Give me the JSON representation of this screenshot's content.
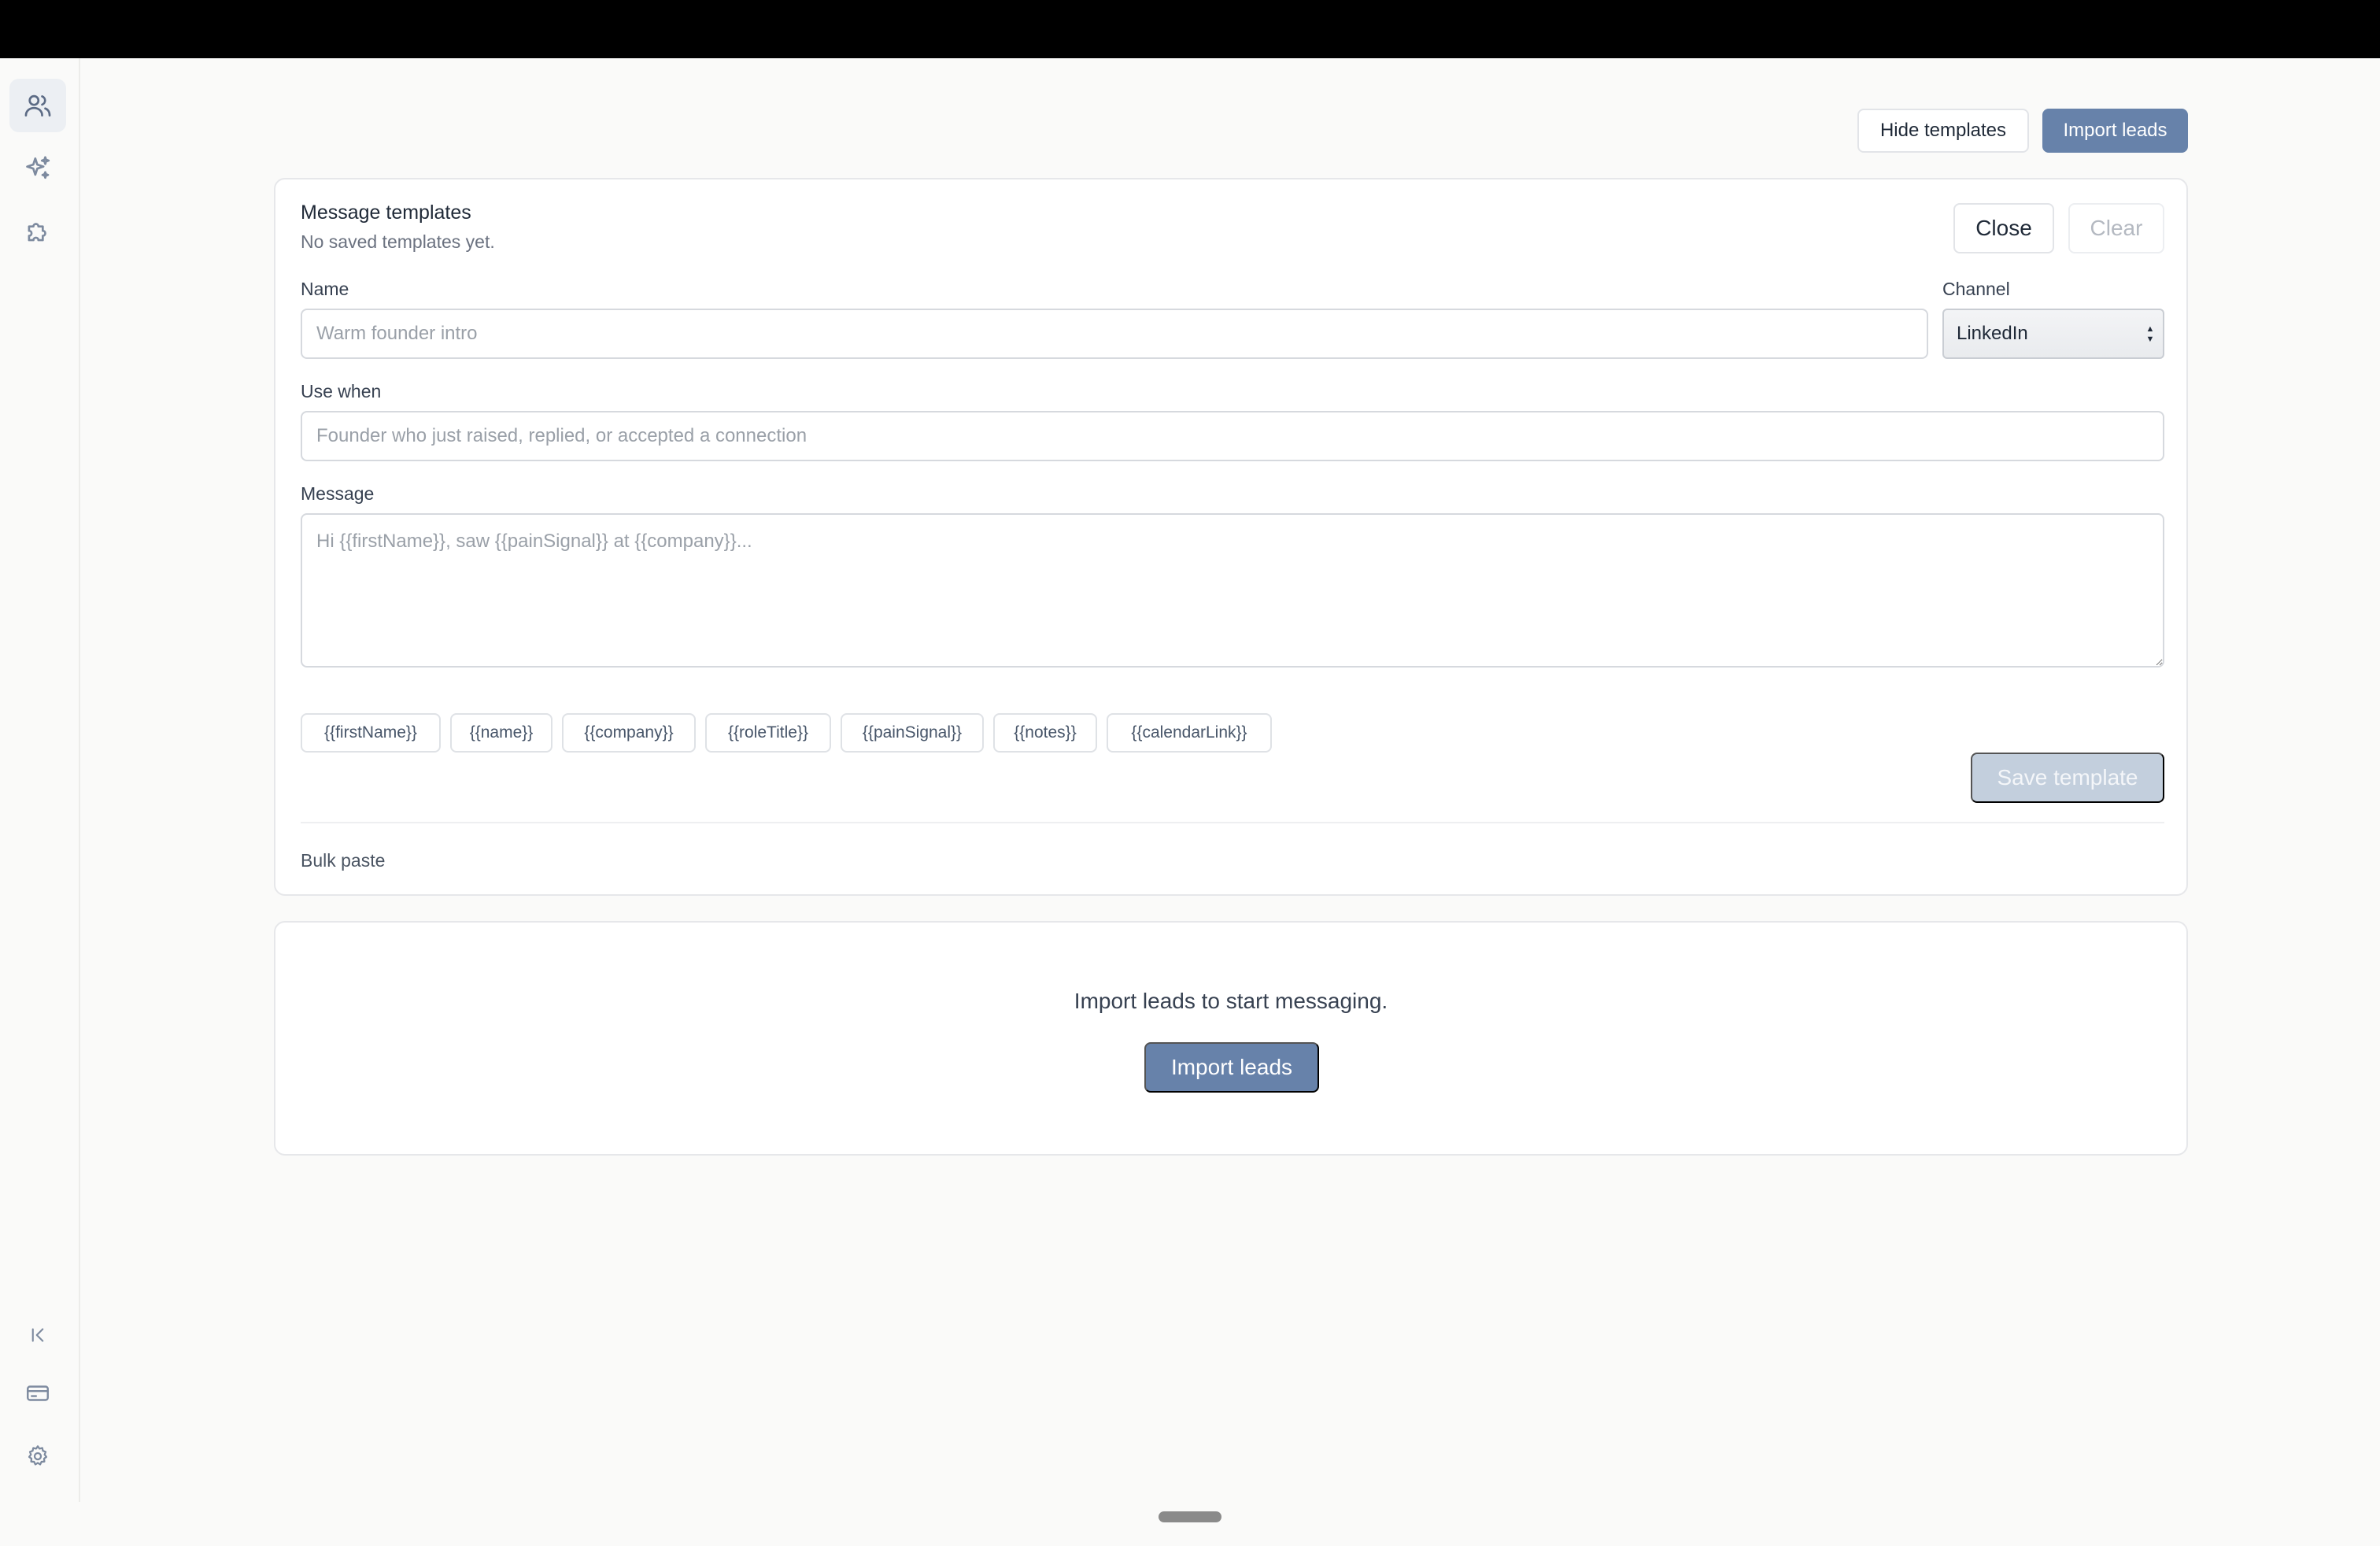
{
  "sidebar": {
    "top_items": [
      {
        "icon": "users-icon",
        "active": true
      },
      {
        "icon": "sparkles-icon",
        "active": false
      },
      {
        "icon": "puzzle-icon",
        "active": false
      }
    ],
    "bottom_items": [
      {
        "icon": "collapse-sidebar-icon"
      },
      {
        "icon": "credit-card-icon"
      },
      {
        "icon": "gear-icon"
      }
    ]
  },
  "toolbar": {
    "hide_templates_label": "Hide templates",
    "import_leads_label": "Import leads"
  },
  "templates_panel": {
    "title": "Message templates",
    "subtitle": "No saved templates yet.",
    "close_label": "Close",
    "clear_label": "Clear",
    "name": {
      "label": "Name",
      "value": "",
      "placeholder": "Warm founder intro"
    },
    "channel": {
      "label": "Channel",
      "selected": "LinkedIn"
    },
    "use_when": {
      "label": "Use when",
      "value": "",
      "placeholder": "Founder who just raised, replied, or accepted a connection"
    },
    "message": {
      "label": "Message",
      "value": "",
      "placeholder": "Hi {{firstName}}, saw {{painSignal}} at {{company}}..."
    },
    "variables": [
      "{{firstName}}",
      "{{name}}",
      "{{company}}",
      "{{roleTitle}}",
      "{{painSignal}}",
      "{{notes}}",
      "{{calendarLink}}"
    ],
    "save_label": "Save template",
    "bulk_paste_label": "Bulk paste"
  },
  "empty_state": {
    "text": "Import leads to start messaging.",
    "button_label": "Import leads"
  },
  "colors": {
    "primary": "#6782aa",
    "primary_disabled": "#c3cfdd",
    "background": "#fafaf9",
    "topbar": "#000000"
  }
}
